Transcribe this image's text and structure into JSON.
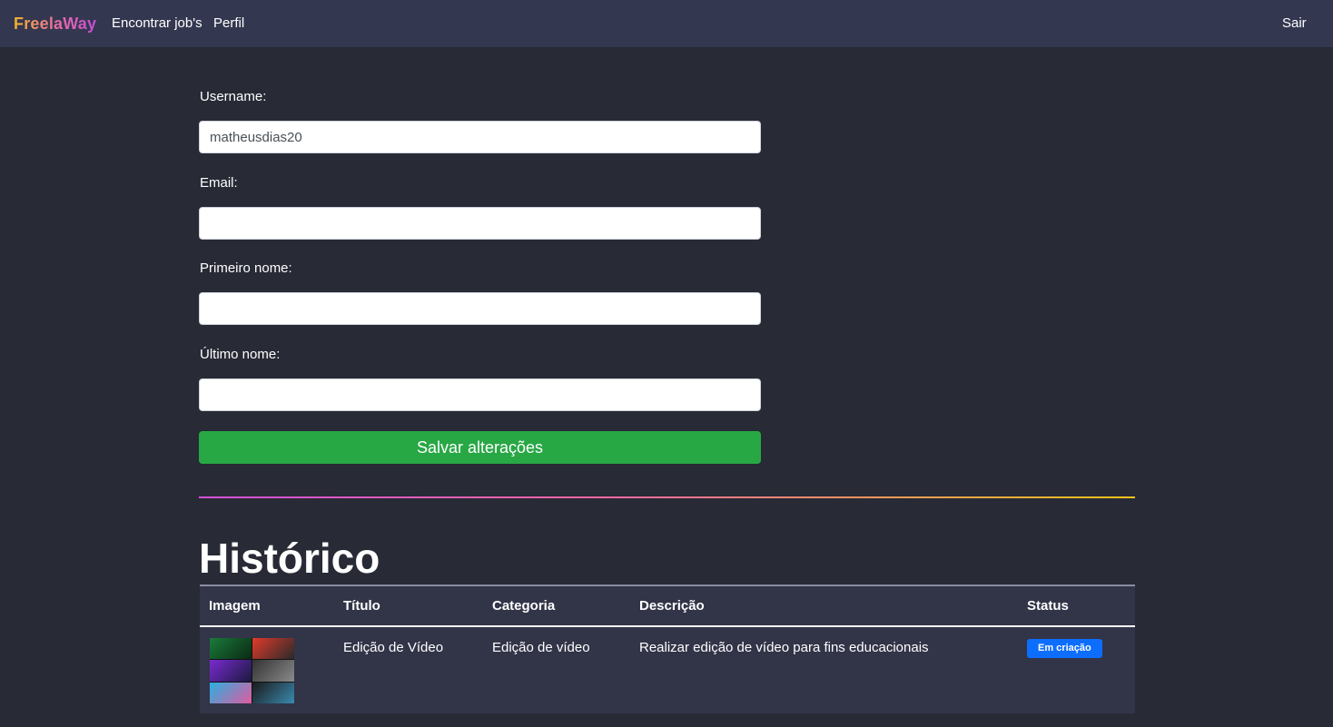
{
  "navbar": {
    "brand": "FreelaWay",
    "links": [
      "Encontrar job's",
      "Perfil"
    ],
    "logout": "Sair"
  },
  "form": {
    "username": {
      "label": "Username:",
      "value": "matheusdias20"
    },
    "email": {
      "label": "Email:",
      "value": ""
    },
    "first_name": {
      "label": "Primeiro nome:",
      "value": ""
    },
    "last_name": {
      "label": "Último nome:",
      "value": ""
    },
    "save_label": "Salvar alterações",
    "save_color": "#28a745"
  },
  "history": {
    "title": "Histórico",
    "columns": [
      "Imagem",
      "Título",
      "Categoria",
      "Descrição",
      "Status"
    ],
    "rows": [
      {
        "image": "video-thumbnails-collage",
        "title": "Edição de Vídeo",
        "category": "Edição de vídeo",
        "description": "Realizar edição de vídeo para fins educacionais",
        "status": "Em criação",
        "status_color": "#0d6efd"
      }
    ]
  }
}
